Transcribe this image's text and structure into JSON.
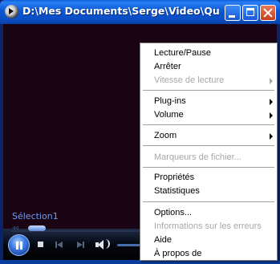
{
  "window": {
    "title": "D:\\Mes Documents\\Serge\\Video\\Quee...",
    "icons": {
      "app": "media-player-icon",
      "minimize": "minimize-icon",
      "maximize": "maximize-icon",
      "close": "close-icon"
    }
  },
  "player": {
    "selection_label": "Sélection1",
    "seek_glyph": "◃◃",
    "colors": {
      "video_background": "#1a0414",
      "accent": "#3876e0",
      "title_bar": "#0a57d4",
      "menu_disabled": "#a7a7a7"
    }
  },
  "context_menu": {
    "items": [
      {
        "label": "Lecture/Pause",
        "enabled": true
      },
      {
        "label": "Arrêter",
        "enabled": true
      },
      {
        "label": "Vitesse de lecture",
        "enabled": false,
        "submenu": true
      },
      {
        "label": "Plug-ins",
        "enabled": true,
        "submenu": true
      },
      {
        "label": "Volume",
        "enabled": true,
        "submenu": true
      },
      {
        "label": "Zoom",
        "enabled": true,
        "submenu": true
      },
      {
        "label": "Marqueurs de fichier...",
        "enabled": false
      },
      {
        "label": "Propriétés",
        "enabled": true
      },
      {
        "label": "Statistiques",
        "enabled": true
      },
      {
        "label": "Options...",
        "enabled": true
      },
      {
        "label": "Informations sur les erreurs",
        "enabled": false
      },
      {
        "label": "Aide",
        "enabled": true
      },
      {
        "label": "À propos de",
        "enabled": true
      }
    ]
  }
}
